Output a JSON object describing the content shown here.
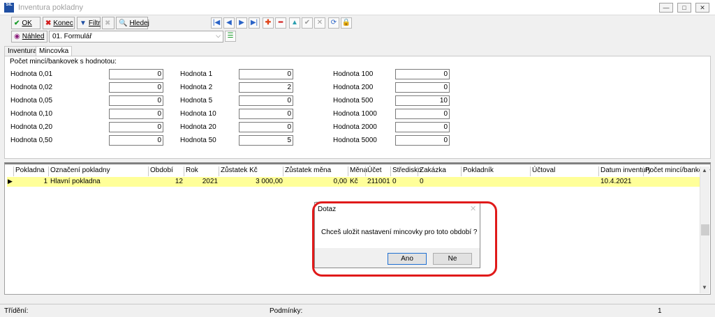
{
  "window": {
    "title": "Inventura pokladny",
    "app_icon_text": "SIL"
  },
  "toolbar": {
    "ok": "OK",
    "konec": "Konec",
    "filtr": "Filtr",
    "hledej": "Hledej"
  },
  "toolbar2": {
    "nahled": "Náhled",
    "form": "01. Formulář"
  },
  "tabs": [
    "Inventura",
    "Mincovka"
  ],
  "coins": {
    "group_label": "Počet mincí/bankovek s hodnotou:",
    "col1": [
      {
        "label": "Hodnota 0,01",
        "value": "0"
      },
      {
        "label": "Hodnota 0,02",
        "value": "0"
      },
      {
        "label": "Hodnota 0,05",
        "value": "0"
      },
      {
        "label": "Hodnota 0,10",
        "value": "0"
      },
      {
        "label": "Hodnota 0,20",
        "value": "0"
      },
      {
        "label": "Hodnota 0,50",
        "value": "0"
      }
    ],
    "col2": [
      {
        "label": "Hodnota 1",
        "value": "0"
      },
      {
        "label": "Hodnota 2",
        "value": "2"
      },
      {
        "label": "Hodnota 5",
        "value": "0"
      },
      {
        "label": "Hodnota 10",
        "value": "0"
      },
      {
        "label": "Hodnota 20",
        "value": "0"
      },
      {
        "label": "Hodnota 50",
        "value": "5"
      }
    ],
    "col3": [
      {
        "label": "Hodnota 100",
        "value": "0"
      },
      {
        "label": "Hodnota 200",
        "value": "0"
      },
      {
        "label": "Hodnota 500",
        "value": "10"
      },
      {
        "label": "Hodnota 1000",
        "value": "0"
      },
      {
        "label": "Hodnota 2000",
        "value": "0"
      },
      {
        "label": "Hodnota 5000",
        "value": "0"
      }
    ]
  },
  "grid": {
    "headers": [
      "Pokladna",
      "Označení pokladny",
      "Období",
      "Rok",
      "Zůstatek Kč",
      "Zůstatek měna",
      "Měna",
      "Účet",
      "Středisko",
      "Zakázka",
      "Pokladník",
      "Účtoval",
      "Datum inventury",
      "Počet mincí/bankove"
    ],
    "row": [
      "1",
      "Hlavní pokladna",
      "12",
      "2021",
      "3 000,00",
      "0,00",
      "Kč",
      "211001",
      "0",
      "0",
      "",
      "",
      "10.4.2021",
      ""
    ]
  },
  "dialog": {
    "title": "Dotaz",
    "message": "Chceš uložit nastavení mincovky pro toto období ?",
    "yes": "Ano",
    "no": "Ne"
  },
  "status": {
    "trideni": "Třídění:",
    "podminky": "Podmínky:",
    "count": "1"
  }
}
